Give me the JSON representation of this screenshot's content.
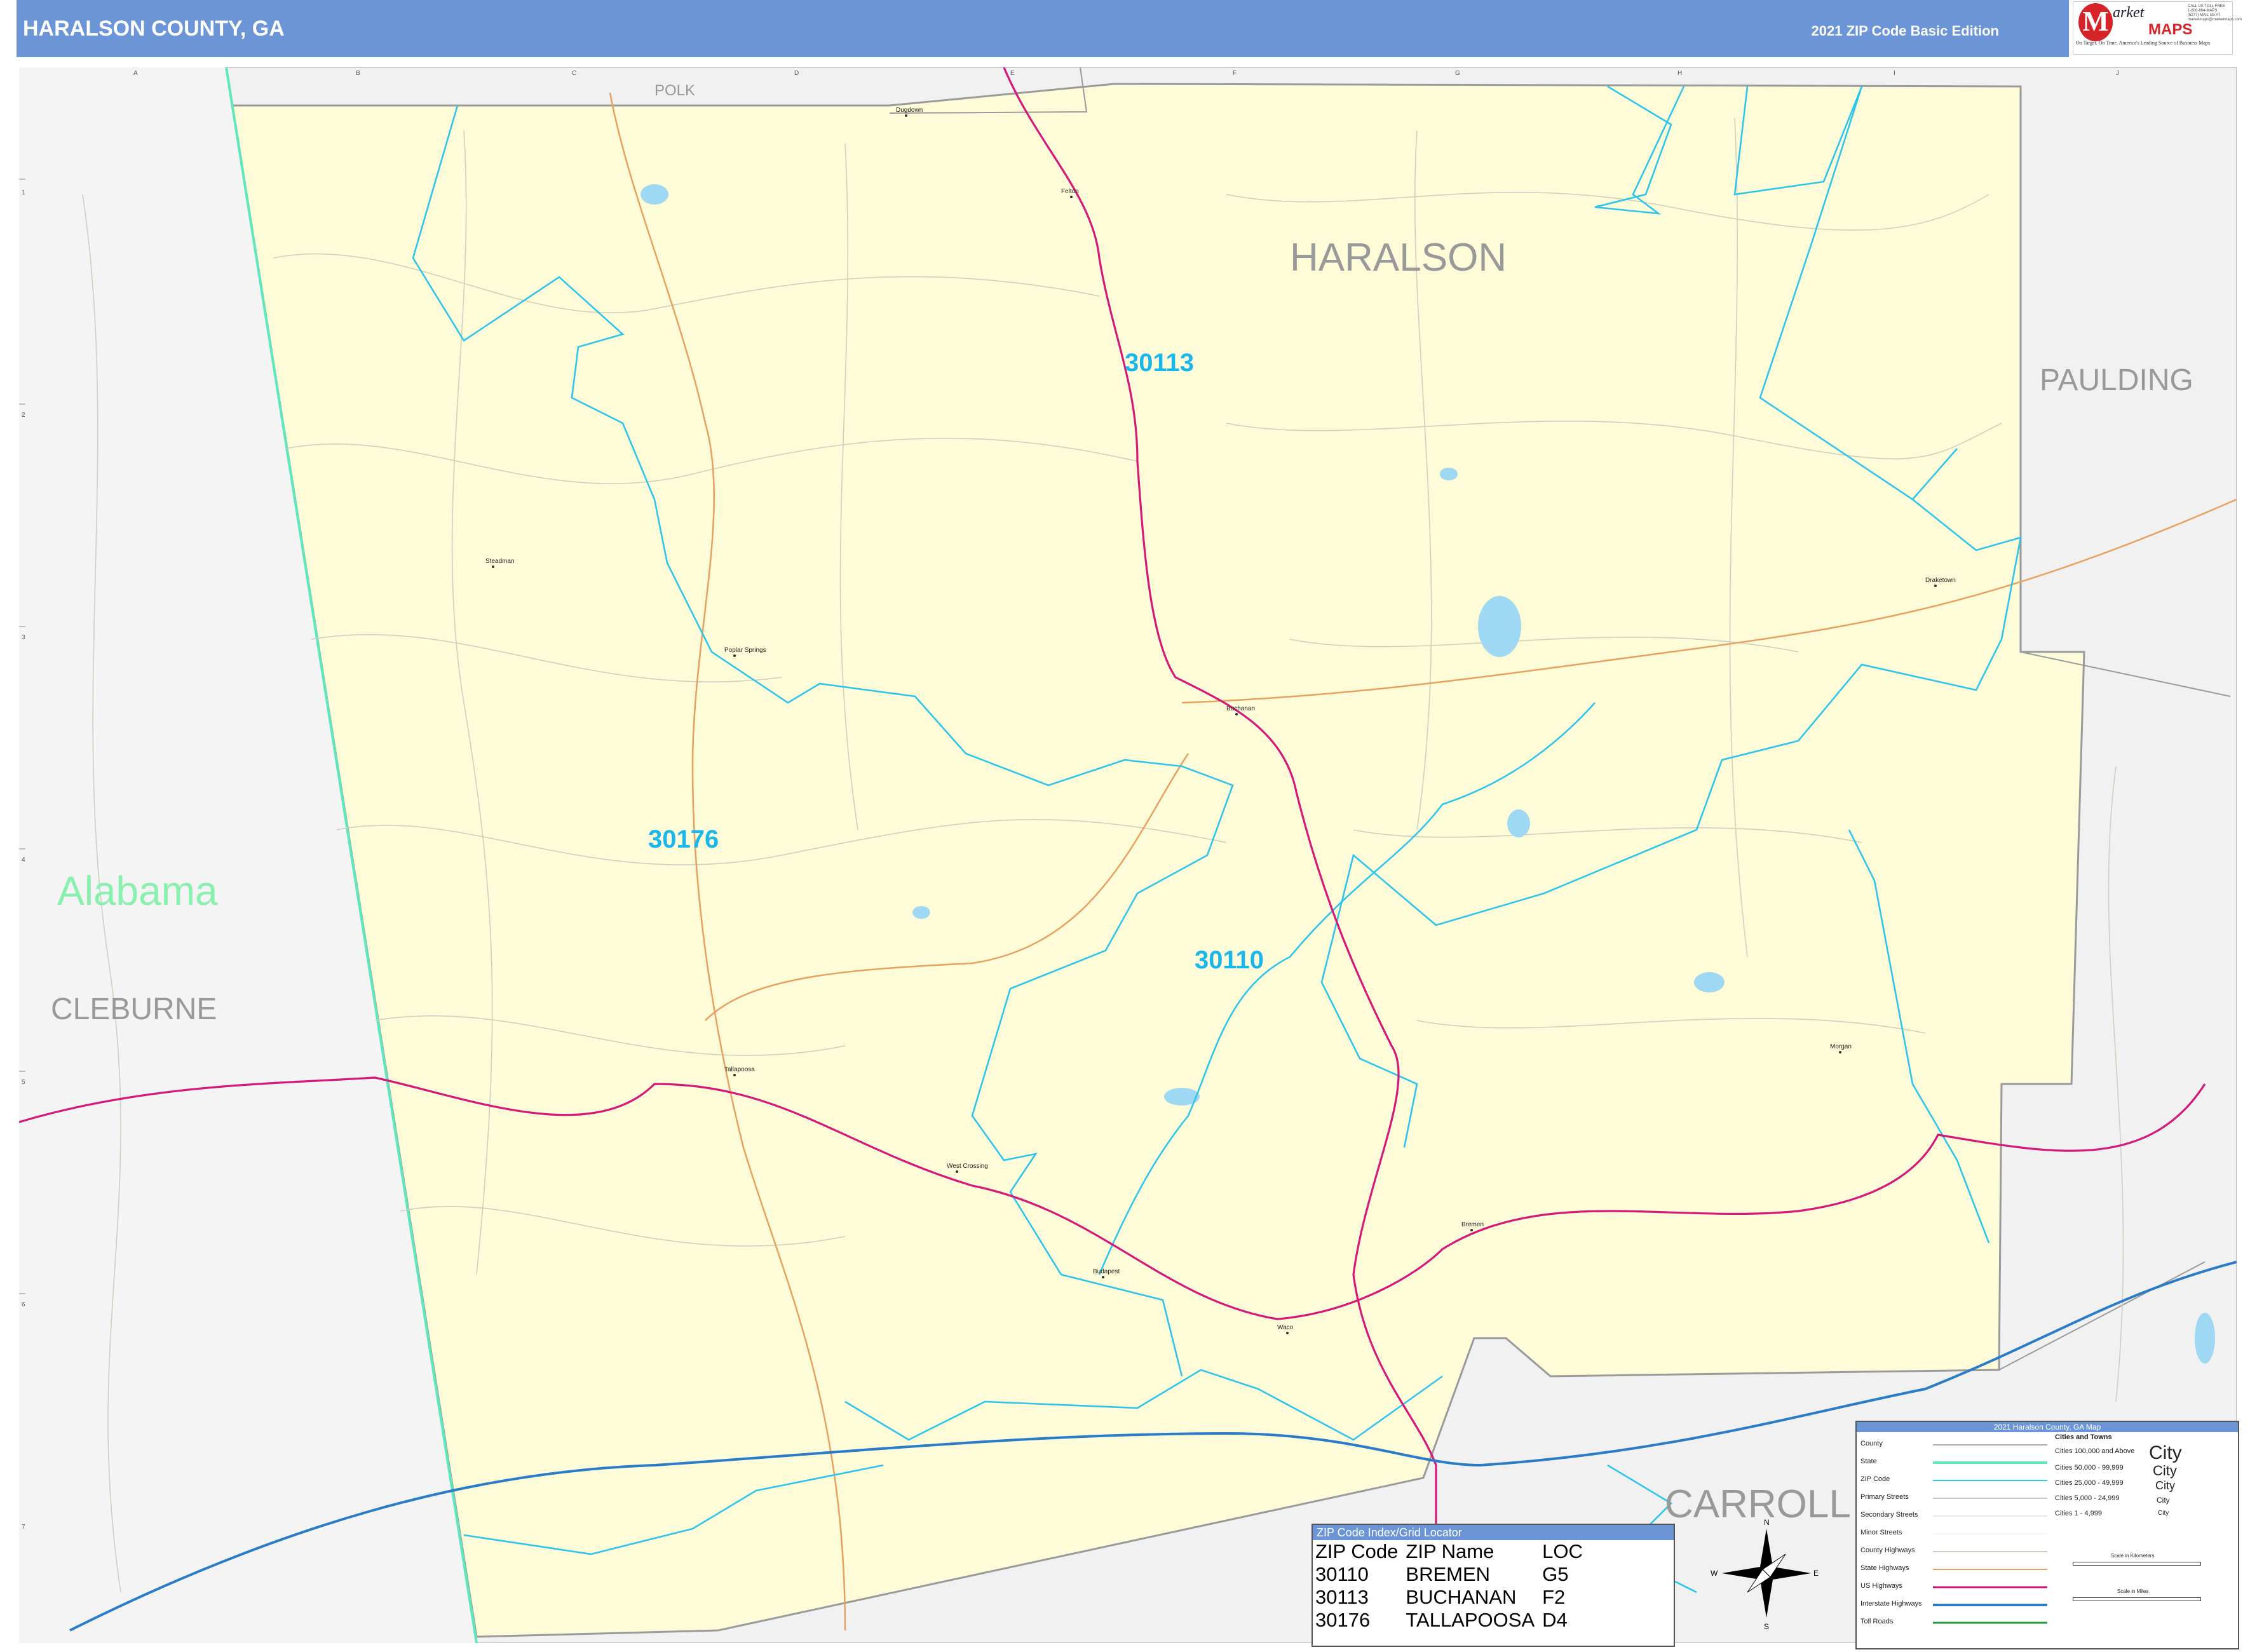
{
  "header": {
    "title": "HARALSON COUNTY, GA",
    "edition": "2021 ZIP Code Basic Edition"
  },
  "logo": {
    "initial": "M",
    "word1": "arket",
    "word2": "MAPS",
    "tagline": "On Target. On Time. America's Leading Source of Business Maps",
    "contact": "CALL US TOLL FREE 1-800-864-MAPS (6277) MAIL US AT marketmaps@marketmaps.com"
  },
  "grid": {
    "columns": [
      "A",
      "B",
      "C",
      "D",
      "E",
      "F",
      "G",
      "H",
      "I",
      "J"
    ],
    "rows": [
      "1",
      "2",
      "3",
      "4",
      "5",
      "6",
      "7"
    ]
  },
  "labels": {
    "county_main": "HARALSON",
    "neighbors": [
      "POLK",
      "PAULDING",
      "CLEBURNE",
      "CARROLL"
    ],
    "state": "Alabama",
    "zips": [
      "30113",
      "30176",
      "30110"
    ]
  },
  "cities": [
    "Dugdown",
    "Felton",
    "Steadman",
    "Poplar Springs",
    "Buchanan",
    "Draketown",
    "Tallapoosa",
    "West Crossing",
    "Morgan",
    "Bremen",
    "Budapest",
    "Waco"
  ],
  "zip_index": {
    "title": "ZIP Code Index/Grid Locator",
    "headers": [
      "ZIP Code",
      "ZIP Name",
      "LOC"
    ],
    "rows": [
      [
        "30110",
        "BREMEN",
        "G5"
      ],
      [
        "30113",
        "BUCHANAN",
        "F2"
      ],
      [
        "30176",
        "TALLAPOOSA",
        "D4"
      ]
    ]
  },
  "compass": {
    "n": "N",
    "s": "S",
    "e": "E",
    "w": "W"
  },
  "legend": {
    "title": "2021 Haralson County, GA Map",
    "line_items": [
      "County",
      "State",
      "ZIP Code",
      "Primary Streets",
      "Secondary Streets",
      "Minor Streets",
      "County Highways",
      "State Highways",
      "US Highways",
      "Interstate Highways",
      "Toll Roads"
    ],
    "cities_title": "Cities and Towns",
    "city_items": [
      "Cities 100,000 and Above",
      "Cities 50,000 - 99,999",
      "Cities 25,000 - 49,999",
      "Cities 5,000 - 24,999",
      "Cities 1 - 4,999"
    ],
    "city_samples": [
      "City",
      "City",
      "City",
      "City",
      "City"
    ],
    "scale_km": "Scale in Kilometers",
    "scale_mi": "Scale in Miles"
  },
  "colors": {
    "header": "#6b95d6",
    "county_fill": "#fefcd8",
    "zip_boundary": "#2ec5ec",
    "zip_label": "#1ab7ec",
    "us_highway": "#d6187a",
    "interstate": "#2a7cc8",
    "state_highway": "#e8a060",
    "state_line": "#5fe8bf",
    "outside_fill": "#f1f1f1"
  }
}
